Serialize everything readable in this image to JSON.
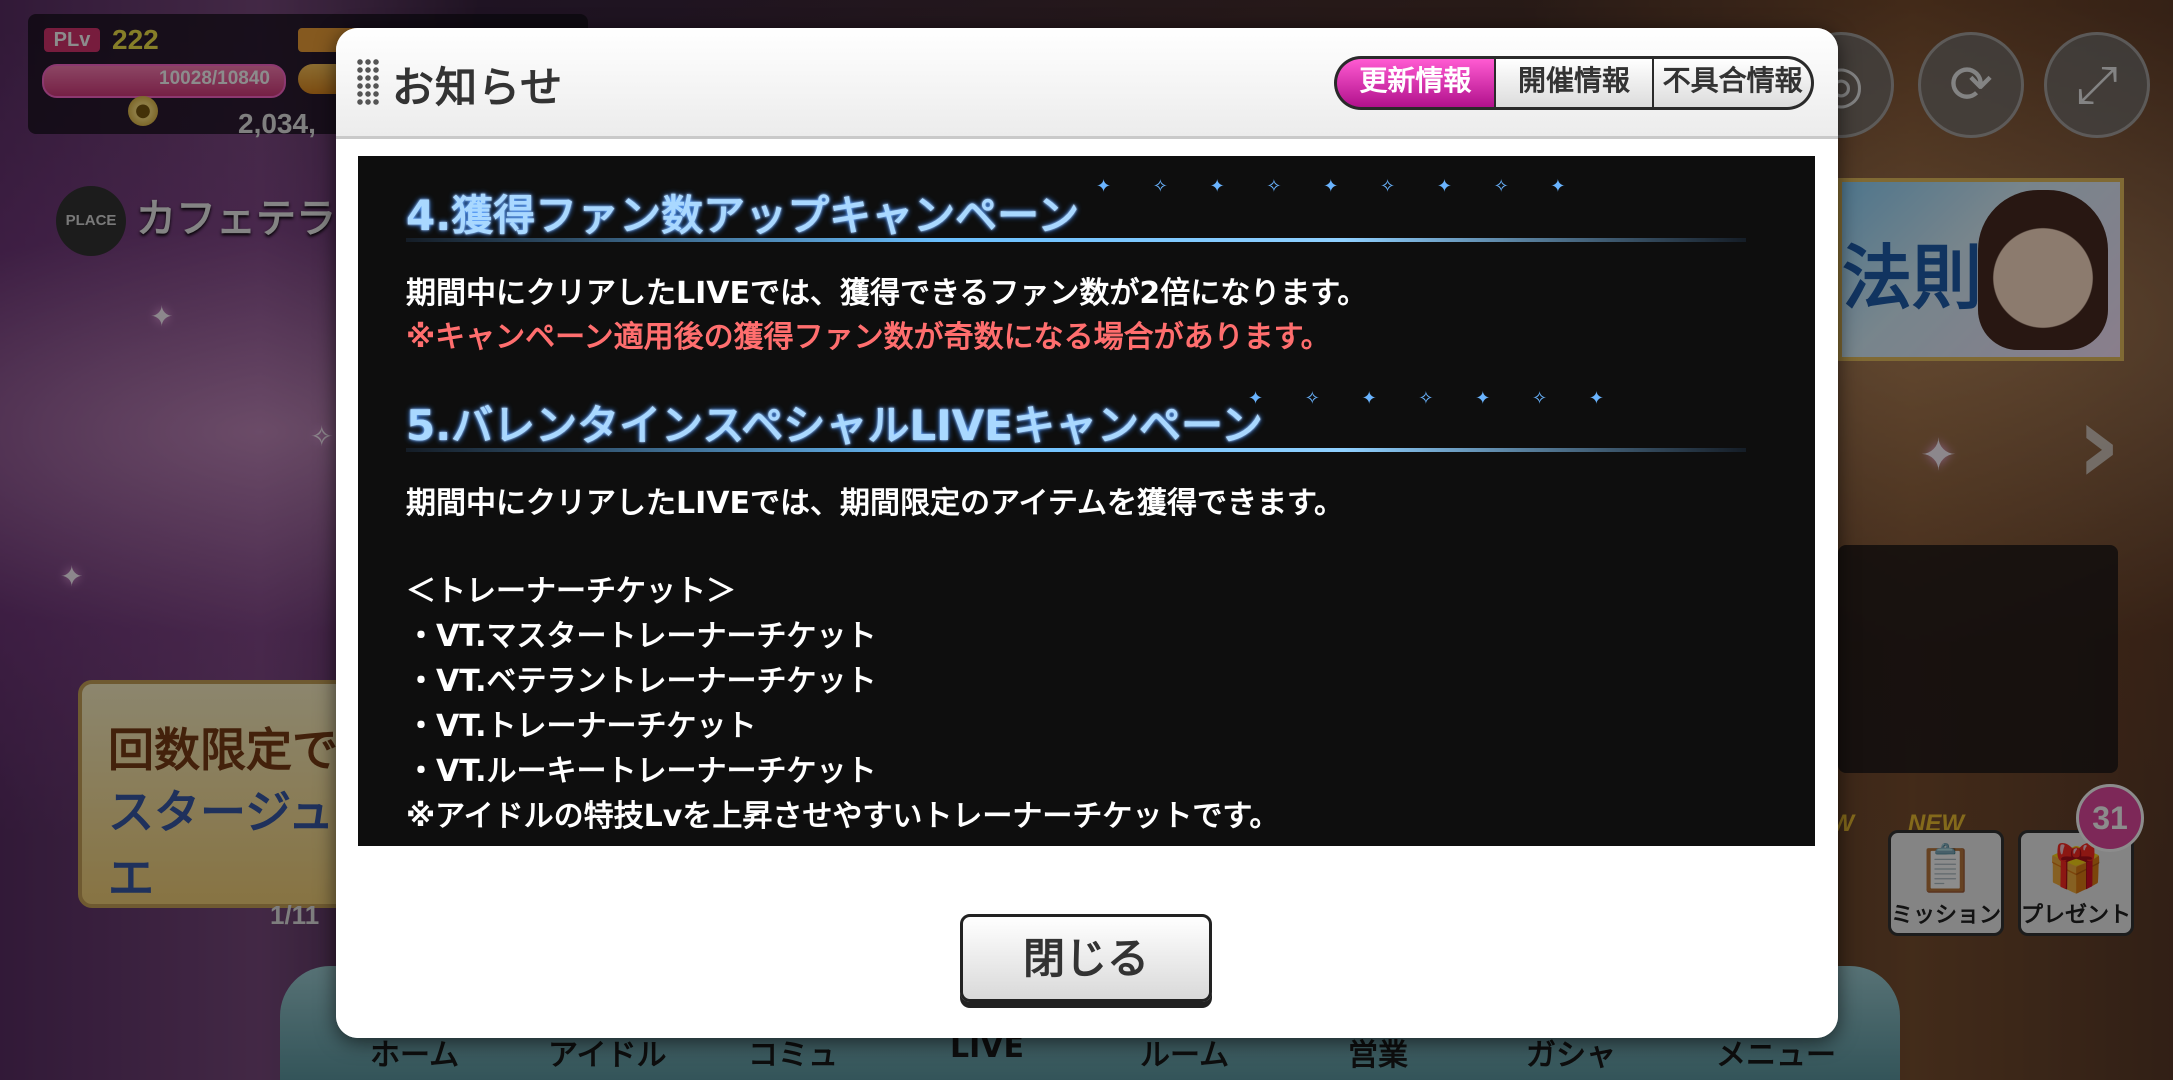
{
  "background": {
    "player_level_tag": "PLv",
    "player_level": "222",
    "stamina": "10028/10840",
    "money": "2,034,",
    "place_tag": "PLACE",
    "place_name": "カフェテラ",
    "banner_line1": "回数限定で",
    "banner_line2": "スタージュエ",
    "banner_page": "1/11",
    "new_tag": "NEW",
    "mission_label": "ミッション",
    "present_label": "プレゼント",
    "present_count": "31",
    "char_card_text": "法則",
    "nav": [
      "ホーム",
      "アイドル",
      "コミュ",
      "LIVE",
      "ルーム",
      "営業",
      "ガシャ",
      "メニュー"
    ]
  },
  "modal": {
    "title": "お知らせ",
    "tabs": [
      "更新情報",
      "開催情報",
      "不具合情報"
    ],
    "sections": [
      {
        "heading": "4.獲得ファン数アップキャンペーン",
        "lines": [
          "期間中にクリアしたLIVEでは、獲得できるファン数が2倍になります。"
        ],
        "note": "※キャンペーン適用後の獲得ファン数が奇数になる場合があります。"
      },
      {
        "heading": "5.バレンタインスペシャルLIVEキャンペーン",
        "lines": [
          "期間中にクリアしたLIVEでは、期間限定のアイテムを獲得できます。",
          "＜トレーナーチケット＞",
          "・VT.マスタートレーナーチケット",
          "・VT.ベテラントレーナーチケット",
          "・VT.トレーナーチケット",
          "・VT.ルーキートレーナーチケット",
          "※アイドルの特技Lvを上昇させやすいトレーナーチケットです。"
        ]
      }
    ],
    "close_label": "閉じる"
  },
  "colors": {
    "active_tab": "#e23bbf",
    "heading_glow": "#3d8fff",
    "note_red": "#ff6e6e"
  }
}
